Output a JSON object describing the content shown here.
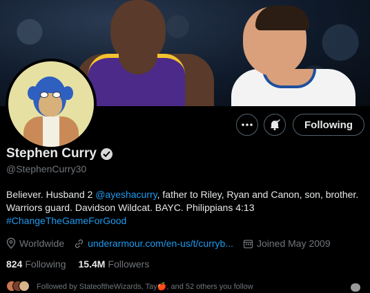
{
  "profile": {
    "name": "Stephen Curry",
    "handle": "@StephenCurry30",
    "bio": {
      "part1": "Believer. Husband 2 ",
      "mention": "@ayeshacurry",
      "part2": ", father to Riley, Ryan and Canon, son, brother. Warriors guard. Davidson Wildcat. BAYC. Philippians 4:13",
      "hashtag": "#ChangeTheGameForGood"
    },
    "location": "Worldwide",
    "website": "underarmour.com/en-us/t/curryb...",
    "joined": "Joined May 2009",
    "following_count": "824",
    "following_label": "Following",
    "followers_count": "15.4M",
    "followers_label": "Followers",
    "followed_by": "Followed by StateoftheWizards, Tay🍎, and 52 others you follow"
  },
  "actions": {
    "more_icon": "more-dots",
    "notify_icon": "bell-check",
    "follow_label": "Following"
  },
  "colors": {
    "background": "#000000",
    "link": "#1d9bf0",
    "muted": "#71767b"
  }
}
